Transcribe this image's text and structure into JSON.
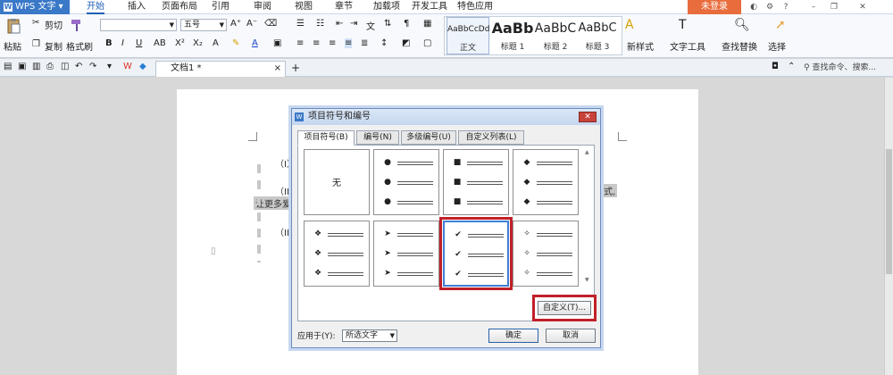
{
  "app": {
    "title": "WPS 文字",
    "login": "未登录"
  },
  "menu": {
    "tabs": [
      "开始",
      "插入",
      "页面布局",
      "引用",
      "审阅",
      "视图",
      "章节",
      "加载项",
      "开发工具",
      "特色应用"
    ]
  },
  "ribbon": {
    "paste": "粘贴",
    "cut": "剪切",
    "copy": "复制",
    "format_painter": "格式刷",
    "font_size": "五号",
    "styles": [
      {
        "preview": "AaBbCcDd",
        "label": "正文"
      },
      {
        "preview": "AaBb",
        "label": "标题 1"
      },
      {
        "preview": "AaBbC",
        "label": "标题 2"
      },
      {
        "preview": "AaBbC",
        "label": "标题 3"
      }
    ],
    "new_style": "新样式",
    "text_tools": "文字工具",
    "find_replace": "查找替换",
    "select": "选择"
  },
  "toolbar2": {
    "doc_tab": "文档1 *",
    "find_placeholder": "查找命令、搜索..."
  },
  "document": {
    "line1": "（I）",
    "line2": "（II）",
    "line3_prefix": "让更多爱",
    "line2_suffix": "式,",
    "line4": "（III"
  },
  "dialog": {
    "title": "项目符号和编号",
    "tabs": [
      "项目符号(B)",
      "编号(N)",
      "多级编号(U)",
      "自定义列表(L)"
    ],
    "none_label": "无",
    "bullets": [
      "●",
      "■",
      "◆",
      "❖",
      "➤",
      "✔",
      "✧"
    ],
    "customize": "自定义(T)...",
    "apply_label": "应用于(Y):",
    "apply_value": "所选文字",
    "ok": "确定",
    "cancel": "取消"
  }
}
